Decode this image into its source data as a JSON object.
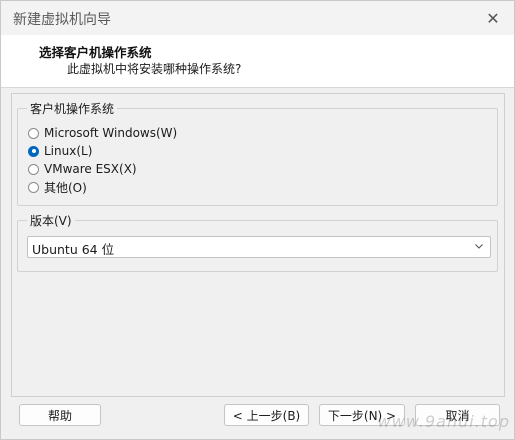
{
  "window": {
    "title": "新建虚拟机向导",
    "close_glyph": "✕"
  },
  "header": {
    "title": "选择客户机操作系统",
    "subtitle": "此虚拟机中将安装哪种操作系统?"
  },
  "os_group": {
    "legend": "客户机操作系统",
    "options": [
      {
        "label": "Microsoft Windows(W)",
        "checked": false
      },
      {
        "label": "Linux(L)",
        "checked": true
      },
      {
        "label": "VMware ESX(X)",
        "checked": false
      },
      {
        "label": "其他(O)",
        "checked": false
      }
    ]
  },
  "version_group": {
    "legend": "版本(V)",
    "selected": "Ubuntu 64 位"
  },
  "buttons": {
    "help": "帮助",
    "back": "< 上一步(B)",
    "next": "下一步(N) >",
    "cancel": "取消"
  },
  "watermark": "www.9ahui.top",
  "colors": {
    "accent": "#0067c0",
    "window_bg": "#f0f0f0",
    "header_bg": "#ffffff"
  },
  "icons": {
    "close": "close-icon",
    "dropdown": "chevron-down-icon"
  }
}
